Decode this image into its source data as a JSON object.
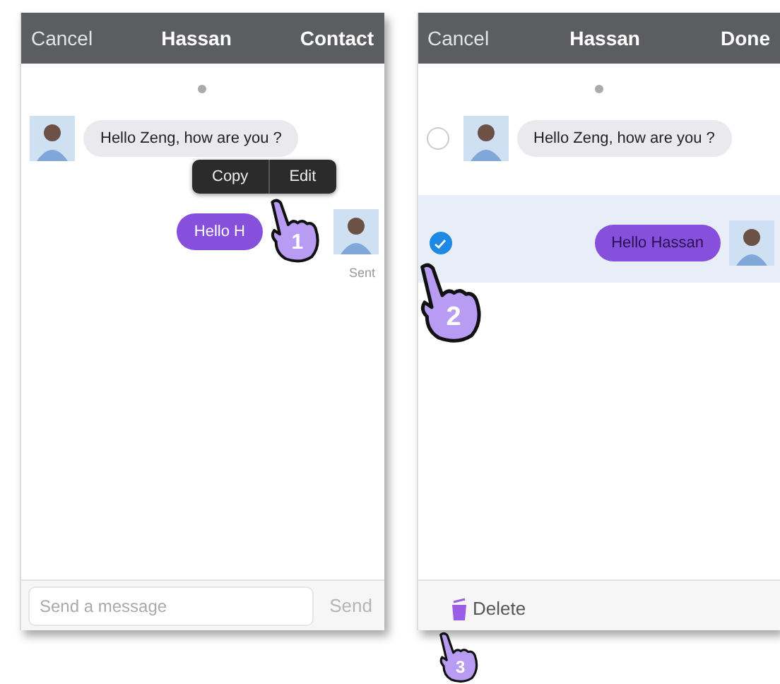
{
  "screens": [
    {
      "header": {
        "left": "Cancel",
        "title": "Hassan",
        "right": "Contact"
      },
      "selection_mode": false,
      "messages": [
        {
          "kind": "received",
          "text": "Hello Zeng, how are you ?"
        },
        {
          "kind": "sent",
          "text": "Hello H",
          "status": "Sent"
        }
      ],
      "context_menu": [
        "Copy",
        "Edit"
      ],
      "footer": {
        "kind": "compose",
        "placeholder": "Send a message",
        "button": "Send"
      }
    },
    {
      "header": {
        "left": "Cancel",
        "title": "Hassan",
        "right": "Done"
      },
      "selection_mode": true,
      "messages": [
        {
          "kind": "received",
          "text": "Hello Zeng, how are you ?",
          "selected": false
        },
        {
          "kind": "sent",
          "text": "Hello Hassan",
          "selected": true
        }
      ],
      "footer": {
        "kind": "delete",
        "label": "Delete"
      }
    }
  ],
  "steps": [
    {
      "number": "1"
    },
    {
      "number": "2"
    },
    {
      "number": "3"
    }
  ]
}
